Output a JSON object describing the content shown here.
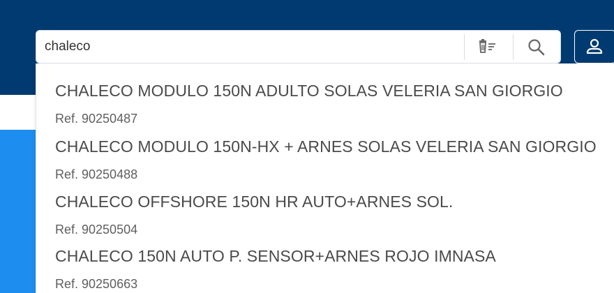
{
  "search": {
    "value": "chaleco",
    "filter_icon": "clear-filter-icon",
    "search_icon": "search-icon"
  },
  "user": {
    "icon": "user-icon"
  },
  "colors": {
    "header_bg": "#003a70",
    "side_panel_bg": "#1d8ef0",
    "text": "#4a4a4a"
  },
  "suggestions": [
    {
      "name": "CHALECO MODULO 150N ADULTO SOLAS VELERIA SAN GIORGIO",
      "ref": "Ref. 90250487"
    },
    {
      "name": "CHALECO MODULO 150N-HX + ARNES SOLAS VELERIA SAN GIORGIO",
      "ref": "Ref. 90250488"
    },
    {
      "name": "CHALECO OFFSHORE 150N HR AUTO+ARNES SOL.",
      "ref": "Ref. 90250504"
    },
    {
      "name": "CHALECO 150N AUTO P. SENSOR+ARNES ROJO IMNASA",
      "ref": "Ref. 90250663"
    }
  ]
}
